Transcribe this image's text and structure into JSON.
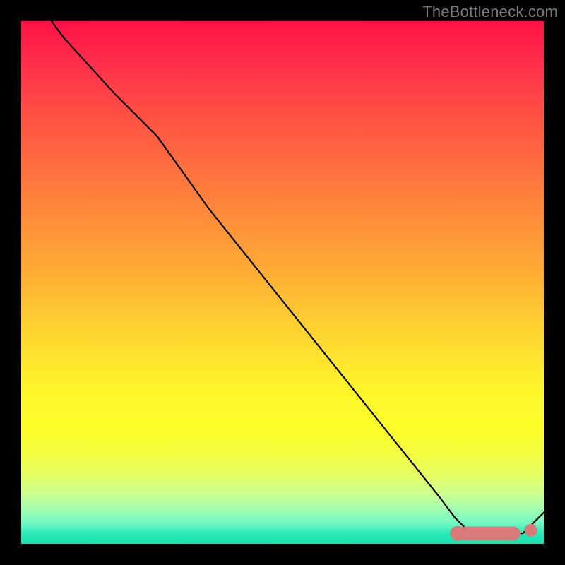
{
  "credit": "TheBottleneck.com",
  "chart_data": {
    "type": "line",
    "title": "",
    "xlabel": "",
    "ylabel": "",
    "xlim": [
      0,
      100
    ],
    "ylim": [
      0,
      100
    ],
    "grid": false,
    "series": [
      {
        "name": "curve",
        "color": "#000000",
        "width": 2.2,
        "x": [
          0,
          8,
          18,
          26,
          36,
          48,
          60,
          72,
          80,
          83,
          85,
          86,
          92,
          95,
          96,
          100
        ],
        "y": [
          108,
          97,
          86,
          78,
          64,
          49,
          34,
          19,
          9,
          5,
          3,
          2,
          2,
          2,
          2,
          6
        ]
      }
    ],
    "markers": [
      {
        "name": "flat-segment",
        "color": "#d97a7a",
        "shape": "roundrect",
        "x0": 83.5,
        "x1": 95.5,
        "y": 2,
        "thickness": 2.6
      },
      {
        "name": "flat-end-dot",
        "color": "#d97a7a",
        "shape": "circle",
        "x": 97.5,
        "y": 2.6,
        "r": 1.2
      }
    ],
    "gradient_stops": [
      {
        "pos": 0,
        "color": "#ff1147"
      },
      {
        "pos": 50,
        "color": "#ffad35"
      },
      {
        "pos": 75,
        "color": "#fff82a"
      },
      {
        "pos": 100,
        "color": "#14e3ae"
      }
    ]
  }
}
